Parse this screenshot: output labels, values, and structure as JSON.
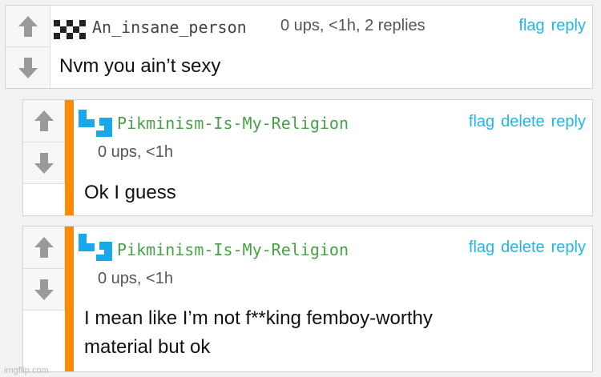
{
  "colors": {
    "link": "#22b5e6",
    "username_green": "#47a146",
    "accent_bar": "#ff8c00"
  },
  "comments": [
    {
      "username": "An_insane_person",
      "meta": "0 ups, <1h, 2 replies",
      "actions": {
        "flag": "flag",
        "reply": "reply"
      },
      "text": "Nvm you ain’t sexy",
      "avatar_icon": "pixel-face-icon"
    },
    {
      "username": "Pikminism-Is-My-Religion",
      "meta": "0 ups, <1h",
      "actions": {
        "flag": "flag",
        "delete": "delete",
        "reply": "reply"
      },
      "text": "Ok I guess",
      "avatar_icon": "pixel-bracket-icon"
    },
    {
      "username": "Pikminism-Is-My-Religion",
      "meta": "0 ups, <1h",
      "actions": {
        "flag": "flag",
        "delete": "delete",
        "reply": "reply"
      },
      "text_line1": "I mean like I’m not f**king femboy-worthy",
      "text_line2": "material but ok",
      "avatar_icon": "pixel-bracket-icon"
    }
  ],
  "watermark": "imgflip.com"
}
